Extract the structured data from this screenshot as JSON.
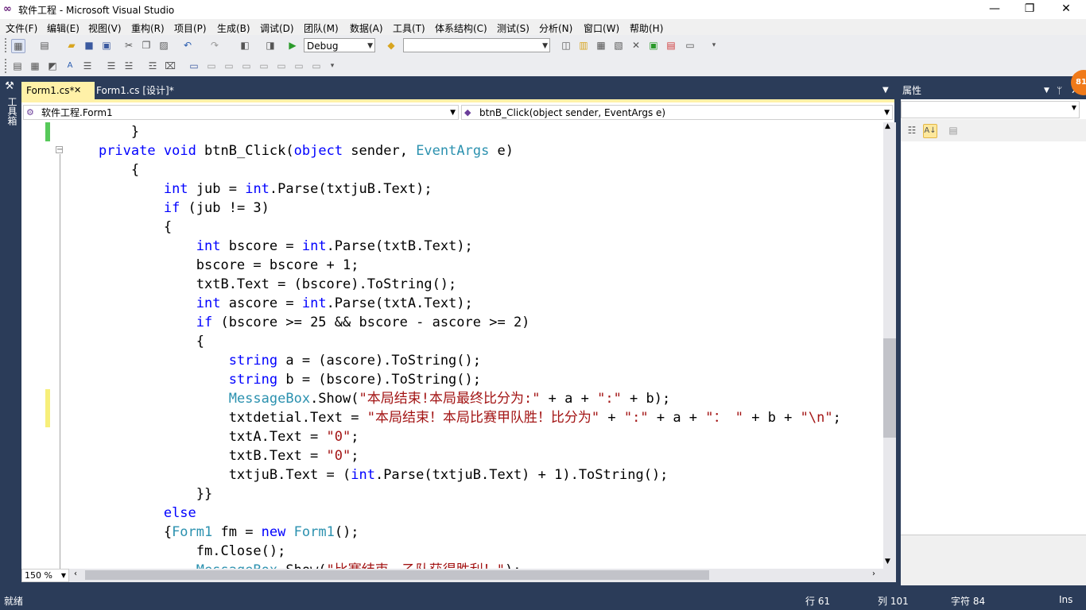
{
  "window": {
    "title": "软件工程 - Microsoft Visual Studio",
    "minimize": "—",
    "restore": "❐",
    "close": "✕"
  },
  "menu": [
    "文件(F)",
    "编辑(E)",
    "视图(V)",
    "重构(R)",
    "项目(P)",
    "生成(B)",
    "调试(D)",
    "团队(M)",
    "数据(A)",
    "工具(T)",
    "体系结构(C)",
    "测试(S)",
    "分析(N)",
    "窗口(W)",
    "帮助(H)"
  ],
  "toolbar": {
    "config": "Debug",
    "platform": ""
  },
  "toolbox": {
    "label": "工具箱"
  },
  "tabs": [
    {
      "label": "Form1.cs*",
      "close": "✕"
    },
    {
      "label": "Form1.cs [设计]*"
    }
  ],
  "nav": {
    "type_selector": "软件工程.Form1",
    "member_selector": "btnB_Click(object sender, EventArgs e)"
  },
  "code_lines": [
    "        }",
    "    private void btnB_Click(object sender, EventArgs e)",
    "        {",
    "            int jub = int.Parse(txtjuB.Text);",
    "            if (jub != 3)",
    "            {",
    "                int bscore = int.Parse(txtB.Text);",
    "                bscore = bscore + 1;",
    "                txtB.Text = (bscore).ToString();",
    "                int ascore = int.Parse(txtA.Text);",
    "                if (bscore >= 25 && bscore - ascore >= 2)",
    "                {",
    "                    string a = (ascore).ToString();",
    "                    string b = (bscore).ToString();",
    "                    MessageBox.Show(\"本局结束!本局最终比分为:\" + a + \":\" + b);",
    "                    txtdetial.Text = \"本局结束！本局比赛甲队胜！比分为\" + \":\" + a + \"： \" + b + \"\\n\";",
    "                    txtA.Text = \"0\";",
    "                    txtB.Text = \"0\";",
    "                    txtjuB.Text = (int.Parse(txtjuB.Text) + 1).ToString();",
    "                }}",
    "            else",
    "            {Form1 fm = new Form1();",
    "                fm.Close();",
    "                MessageBox.Show(\"比赛结束，乙队获得胜利！\");"
  ],
  "zoom": "150 %",
  "properties": {
    "title": "属性",
    "pin": "ᛘ",
    "close": "✕"
  },
  "notification": "81",
  "status": {
    "ready": "就绪",
    "line": "行 61",
    "col": "列 101",
    "char": "字符 84",
    "mode": "Ins"
  },
  "colors": {
    "keyword": "#0000ff",
    "type": "#2b91af",
    "string": "#a31515",
    "chrome": "#2b3c59",
    "active_tab": "#fff1a8"
  }
}
